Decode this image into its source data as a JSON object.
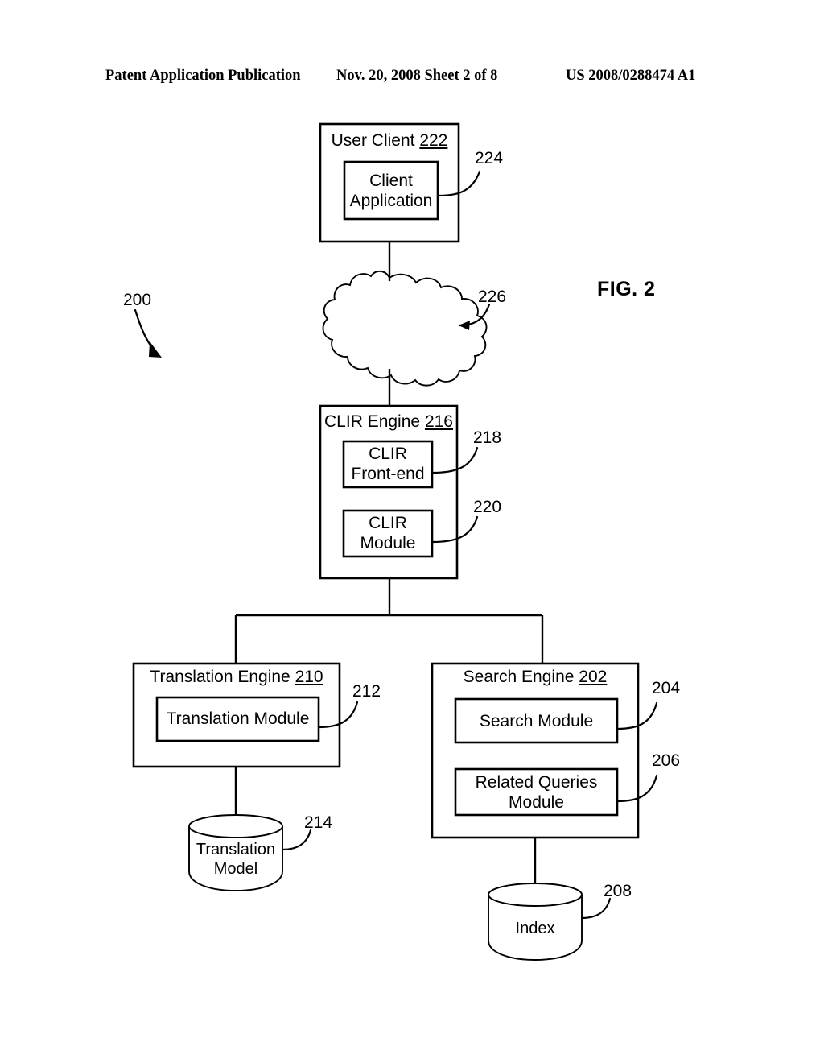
{
  "header": {
    "left": "Patent Application Publication",
    "middle": "Nov. 20, 2008  Sheet 2 of 8",
    "right": "US 2008/0288474 A1"
  },
  "figure": {
    "label": "FIG. 2",
    "system_ref": "200"
  },
  "diagram": {
    "type": "block-diagram",
    "nodes": [
      {
        "id": "user-client",
        "shape": "rect",
        "title": "User Client",
        "ref": "222",
        "children": [
          {
            "id": "client-application",
            "shape": "rect",
            "text_line1": "Client",
            "text_line2": "Application",
            "ref": "224"
          }
        ]
      },
      {
        "id": "network-cloud",
        "shape": "cloud",
        "title": "",
        "ref": "226"
      },
      {
        "id": "clir-engine",
        "shape": "rect",
        "title": "CLIR Engine",
        "ref": "216",
        "children": [
          {
            "id": "clir-front-end",
            "shape": "rect",
            "text_line1": "CLIR",
            "text_line2": "Front-end",
            "ref": "218"
          },
          {
            "id": "clir-module",
            "shape": "rect",
            "text_line1": "CLIR",
            "text_line2": "Module",
            "ref": "220"
          }
        ]
      },
      {
        "id": "translation-engine",
        "shape": "rect",
        "title": "Translation Engine",
        "ref": "210",
        "children": [
          {
            "id": "translation-module",
            "shape": "rect",
            "text_line1": "Translation Module",
            "text_line2": "",
            "ref": "212"
          }
        ]
      },
      {
        "id": "search-engine",
        "shape": "rect",
        "title": "Search Engine",
        "ref": "202",
        "children": [
          {
            "id": "search-module",
            "shape": "rect",
            "text_line1": "Search Module",
            "text_line2": "",
            "ref": "204"
          },
          {
            "id": "related-queries-module",
            "shape": "rect",
            "text_line1": "Related Queries",
            "text_line2": "Module",
            "ref": "206"
          }
        ]
      },
      {
        "id": "translation-model",
        "shape": "cylinder",
        "text_line1": "Translation",
        "text_line2": "Model",
        "ref": "214"
      },
      {
        "id": "index",
        "shape": "cylinder",
        "text_line1": "Index",
        "text_line2": "",
        "ref": "208"
      }
    ],
    "edges": [
      {
        "from": "user-client",
        "to": "network-cloud"
      },
      {
        "from": "network-cloud",
        "to": "clir-engine"
      },
      {
        "from": "clir-engine",
        "to": "translation-engine"
      },
      {
        "from": "clir-engine",
        "to": "search-engine"
      },
      {
        "from": "translation-engine",
        "to": "translation-model"
      },
      {
        "from": "search-engine",
        "to": "index"
      }
    ]
  },
  "colors": {
    "ink": "#000000",
    "paper": "#ffffff"
  }
}
